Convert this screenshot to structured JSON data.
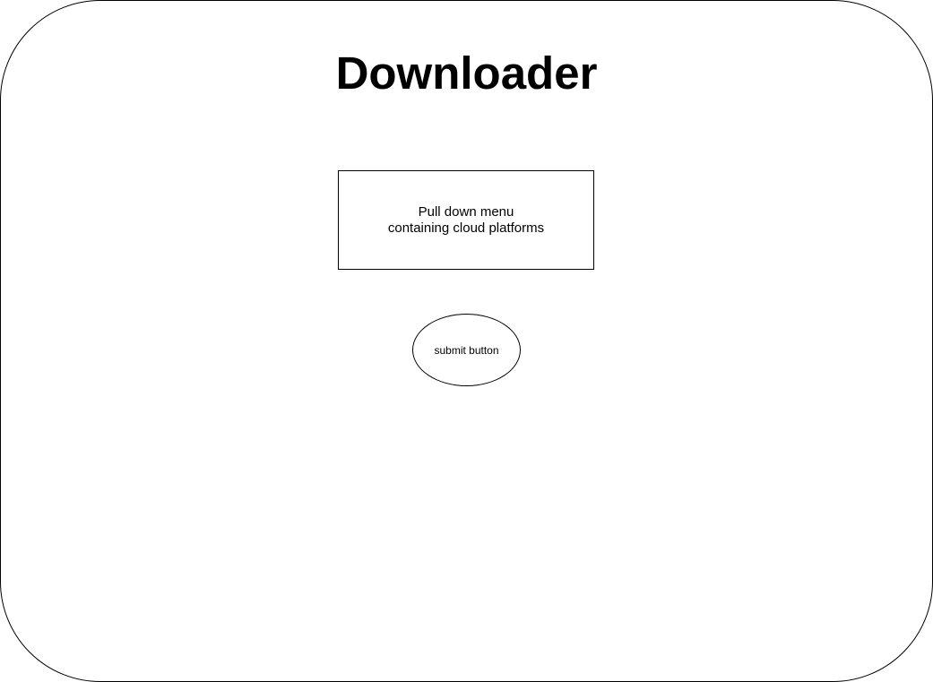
{
  "title": "Downloader",
  "dropdown": {
    "line1": "Pull down menu",
    "line2": "containing cloud platforms"
  },
  "submit": {
    "label": "submit button"
  }
}
